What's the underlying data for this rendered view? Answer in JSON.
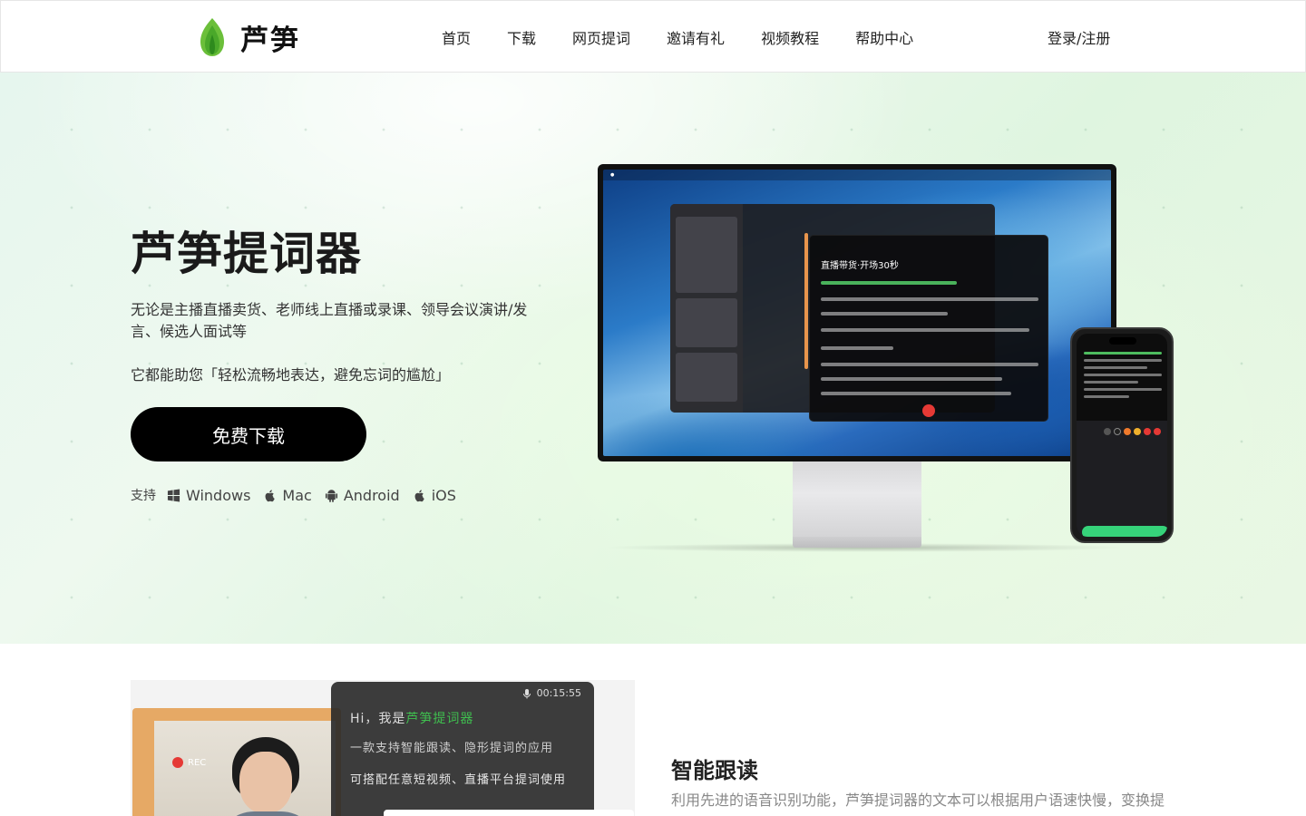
{
  "header": {
    "brand": "芦笋",
    "nav": [
      "首页",
      "下载",
      "网页提词",
      "邀请有礼",
      "视频教程",
      "帮助中心"
    ],
    "login": "登录/注册"
  },
  "hero": {
    "title": "芦笋提词器",
    "description": "无论是主播直播卖货、老师线上直播或录课、领导会议演讲/发言、候选人面试等",
    "tagline": "它都能助您「轻松流畅地表达，避免忘词的尴尬」",
    "download_button": "免费下载",
    "support_label": "支持",
    "platforms": [
      {
        "name": "Windows",
        "icon": "windows-icon"
      },
      {
        "name": "Mac",
        "icon": "apple-icon"
      },
      {
        "name": "Android",
        "icon": "android-icon"
      },
      {
        "name": "iOS",
        "icon": "apple-icon"
      }
    ]
  },
  "mockup": {
    "teleprompter_title": "直播带货·开场30秒"
  },
  "feature": {
    "recording_label": "REC",
    "timer": "00:15:55",
    "line1_prefix": "Hi，我是",
    "line1_highlight": "芦笋提词器",
    "line2": "一款支持智能跟读、隐形提词的应用",
    "line3": "可搭配任意短视频、直播平台提词使用",
    "title": "智能跟读",
    "description": "利用先进的语音识别功能，芦笋提词器的文本可以根据用户语速快慢，变换提词器滚动速度，完美贴合用户讲述"
  },
  "colors": {
    "brand_green": "#3fbf4f",
    "button_black": "#000000",
    "record_red": "#e53935"
  }
}
